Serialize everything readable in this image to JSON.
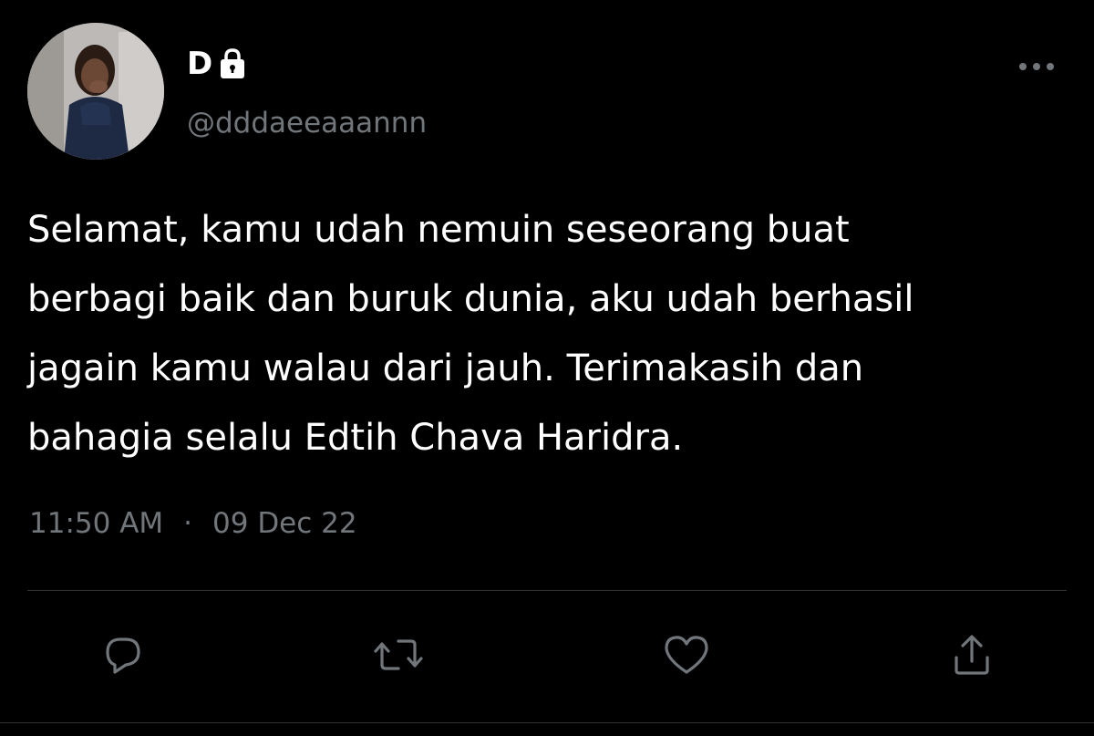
{
  "tweet": {
    "author": {
      "display_name": "D",
      "protected_icon": "lock-icon",
      "handle": "@dddaeeaaannn"
    },
    "more_icon": "more-horizontal-icon",
    "text_lines": [
      "Selamat, kamu udah nemuin seseorang buat",
      "berbagi baik dan buruk dunia, aku udah berhasil",
      "jagain kamu walau dari jauh. Terimakasih dan",
      "bahagia selalu Edtih Chava Haridra."
    ],
    "time": "11:50 AM",
    "separator": "·",
    "date": "09 Dec 22",
    "actions": [
      {
        "name": "reply",
        "icon": "reply-icon"
      },
      {
        "name": "retweet",
        "icon": "retweet-icon"
      },
      {
        "name": "like",
        "icon": "heart-icon"
      },
      {
        "name": "share",
        "icon": "share-icon"
      }
    ]
  },
  "colors": {
    "background": "#000000",
    "primary_text": "#ffffff",
    "secondary_text": "#71767b",
    "divider": "#2f3336"
  }
}
